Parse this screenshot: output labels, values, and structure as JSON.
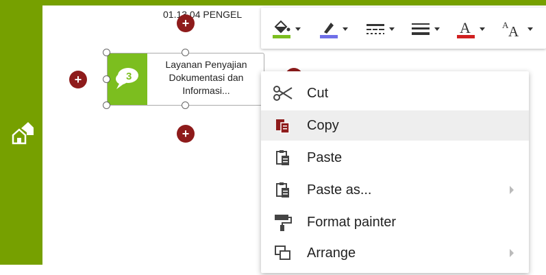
{
  "diagram": {
    "title_text": "01.13.04 PENGEL",
    "node": {
      "text": "Layanan Penyajian Dokumentasi dan Informasi..."
    }
  },
  "toolbar": {
    "buttons": [
      {
        "icon": "fill-color-icon"
      },
      {
        "icon": "line-color-icon"
      },
      {
        "icon": "line-style-icon"
      },
      {
        "icon": "line-width-icon"
      },
      {
        "icon": "font-color-icon",
        "label": "A"
      },
      {
        "icon": "font-size-icon",
        "label": "AA"
      }
    ]
  },
  "context_menu": {
    "items": [
      {
        "label": "Cut",
        "icon": "scissors-icon"
      },
      {
        "label": "Copy",
        "icon": "copy-icon"
      },
      {
        "label": "Paste",
        "icon": "paste-icon"
      },
      {
        "label": "Paste as...",
        "icon": "paste-as-icon"
      },
      {
        "label": "Format painter",
        "icon": "paint-roller-icon"
      },
      {
        "label": "Arrange",
        "icon": "arrange-icon"
      }
    ]
  },
  "colors": {
    "sidebar": "#76a000",
    "node_icon_bg": "#7cbe1f",
    "add_button": "#8e1b1b",
    "fill_swatch": "#7cbe1f",
    "line_swatch": "#6f6fe8",
    "font_swatch": "#d02020"
  }
}
